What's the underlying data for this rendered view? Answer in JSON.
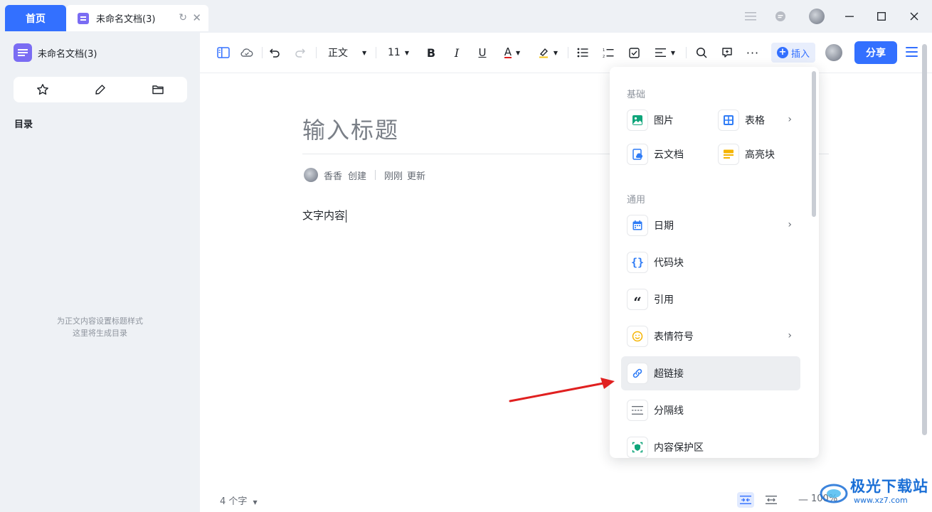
{
  "tabs": {
    "home_label": "首页",
    "doc_label": "未命名文档(3)"
  },
  "sidebar": {
    "doc_title": "未命名文档(3)",
    "toc_heading": "目录",
    "toc_empty_line1": "为正文内容设置标题样式",
    "toc_empty_line2": "这里将生成目录"
  },
  "toolbar": {
    "style_label": "正文",
    "font_size": "11",
    "insert_label": "插入",
    "share_label": "分享"
  },
  "document": {
    "title_placeholder": "输入标题",
    "author": "香香",
    "created_label": "创建",
    "updated_time": "刚刚",
    "updated_label": "更新",
    "body_text": "文字内容"
  },
  "status": {
    "word_count": "4 个字",
    "zoom": "100%"
  },
  "insert_menu": {
    "section_basic": "基础",
    "section_common": "通用",
    "items": {
      "image": "图片",
      "table": "表格",
      "cloud_doc": "云文档",
      "highlight_block": "高亮块",
      "date": "日期",
      "code_block": "代码块",
      "quote": "引用",
      "emoji": "表情符号",
      "hyperlink": "超链接",
      "divider": "分隔线",
      "protected_area": "内容保护区"
    }
  },
  "watermark": {
    "text": "极光下载站",
    "url": "www.xz7.com"
  },
  "colors": {
    "accent": "#3370ff",
    "doc_icon": "#7a6cf3",
    "arrow": "#e02020"
  }
}
